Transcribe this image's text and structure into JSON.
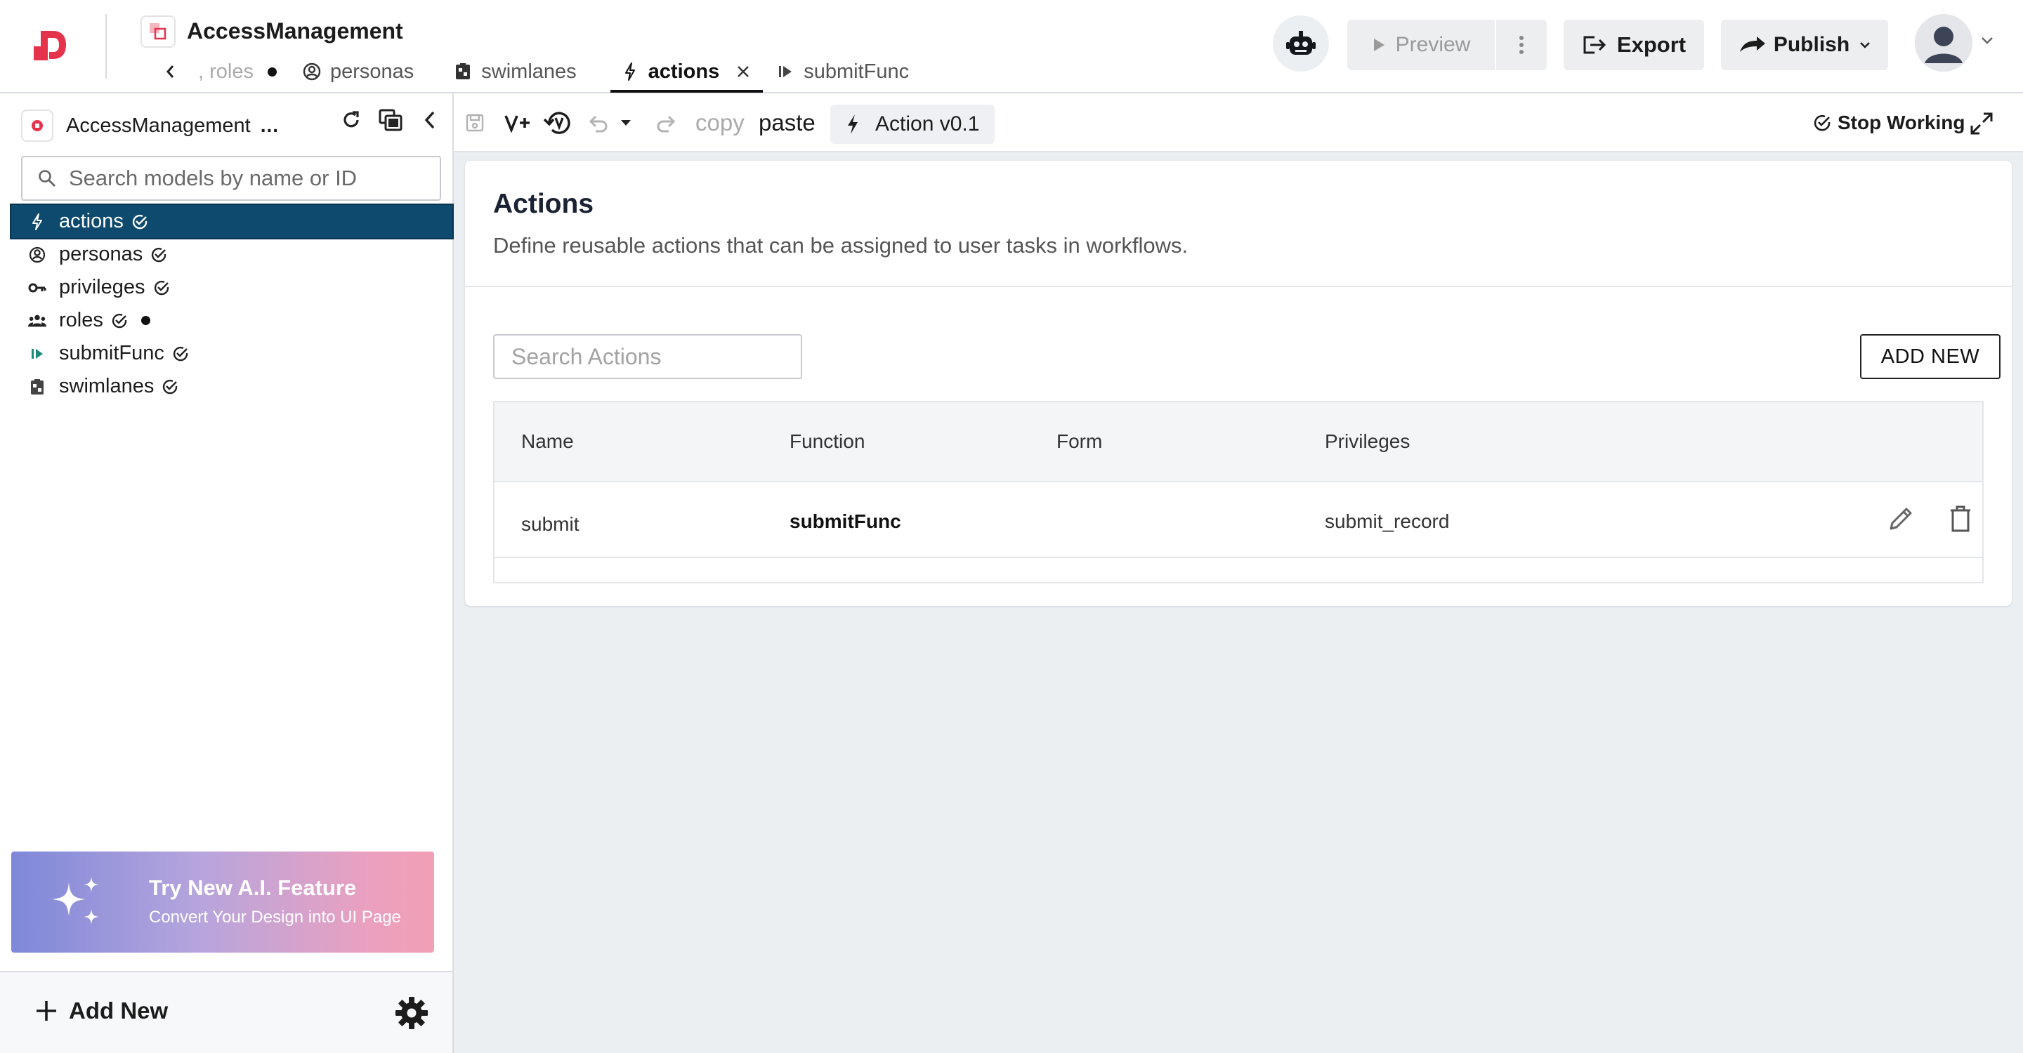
{
  "header": {
    "app_title": "AccessManagement",
    "tabs": [
      {
        "label": ", roles",
        "icon": "roles-icon",
        "unsaved": true
      },
      {
        "label": "personas",
        "icon": "persona-icon"
      },
      {
        "label": "swimlanes",
        "icon": "swimlane-icon"
      },
      {
        "label": "actions",
        "icon": "bolt-icon",
        "active": true
      },
      {
        "label": "submitFunc",
        "icon": "function-icon"
      }
    ],
    "preview_label": "Preview",
    "export_label": "Export",
    "publish_label": "Publish"
  },
  "sidebar": {
    "project_name": "AccessManagement",
    "project_more": "...",
    "search_placeholder": "Search models by name or ID",
    "items": [
      {
        "label": "actions",
        "icon": "bolt-icon",
        "selected": true
      },
      {
        "label": "personas",
        "icon": "persona-icon"
      },
      {
        "label": "privileges",
        "icon": "key-icon"
      },
      {
        "label": "roles",
        "icon": "roles-icon",
        "unsaved": true
      },
      {
        "label": "submitFunc",
        "icon": "function-icon"
      },
      {
        "label": "swimlanes",
        "icon": "swimlane-icon"
      }
    ],
    "ai_banner": {
      "title": "Try New A.I. Feature",
      "subtitle": "Convert Your Design into UI Page"
    },
    "add_new_label": "Add New"
  },
  "toolbar": {
    "copy_label": "copy",
    "paste_label": "paste",
    "version_label": "Action v0.1",
    "stop_working_label": "Stop Working"
  },
  "content": {
    "title": "Actions",
    "description": "Define reusable actions that can be assigned to user tasks in workflows.",
    "search_placeholder": "Search Actions",
    "add_new_button": "ADD NEW",
    "table": {
      "columns": [
        "Name",
        "Function",
        "Form",
        "Privileges"
      ],
      "rows": [
        {
          "name": "submit",
          "function": "submitFunc",
          "form": "",
          "privileges": "submit_record"
        }
      ]
    }
  },
  "colors": {
    "brand": "#e5334b",
    "selected_row": "#0d4a6e",
    "teal_icon": "#1a8a7a"
  }
}
